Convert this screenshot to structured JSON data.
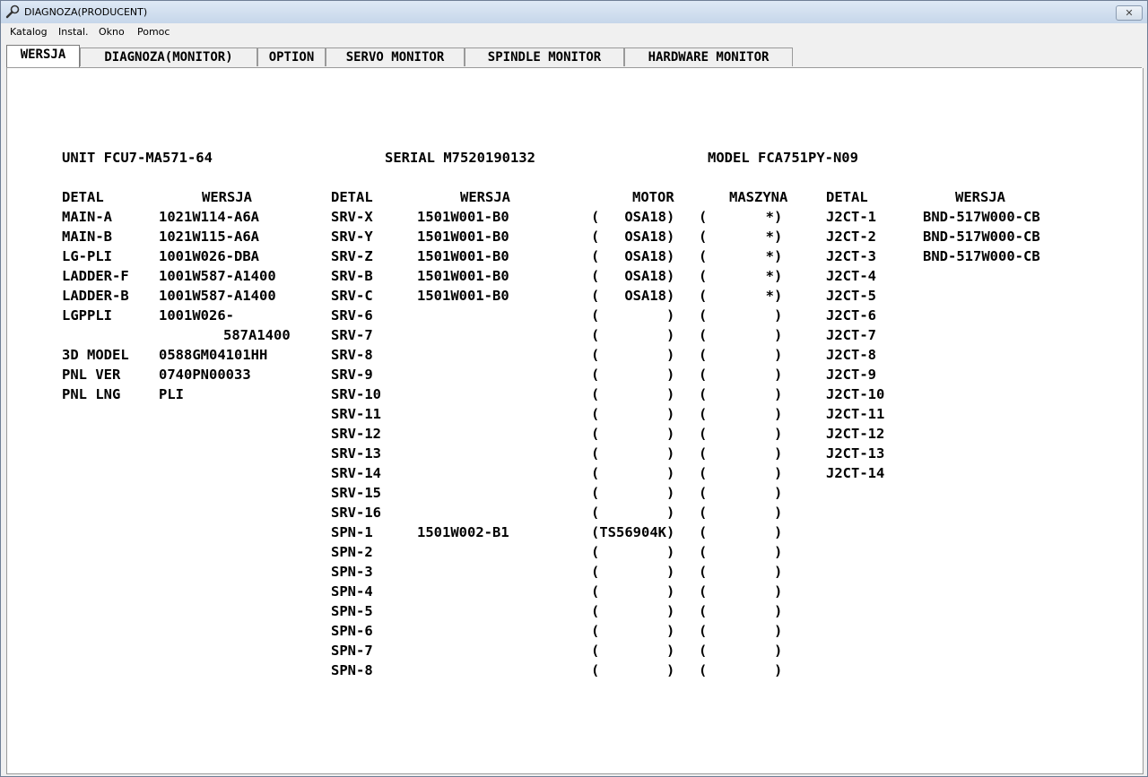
{
  "window": {
    "title": "DIAGNOZA(PRODUCENT)",
    "close_label": "✕"
  },
  "menu": [
    "Katalog",
    "Instal.",
    "Okno",
    "Pomoc"
  ],
  "tabs": [
    "WERSJA",
    "DIAGNOZA(MONITOR)",
    "OPTION",
    "SERVO MONITOR",
    "SPINDLE MONITOR",
    "HARDWARE MONITOR"
  ],
  "header": {
    "unit": "UNIT FCU7-MA571-64",
    "serial": "SERIAL M7520190132",
    "model": "MODEL FCA751PY-N09"
  },
  "columns": {
    "detal": "DETAL",
    "wersja": "WERSJA",
    "motor": "MOTOR",
    "maszyna": "MASZYNA"
  },
  "left_table": [
    {
      "detal": "MAIN-A",
      "wersja": "1021W114-A6A"
    },
    {
      "detal": "MAIN-B",
      "wersja": "1021W115-A6A"
    },
    {
      "detal": "LG-PLI",
      "wersja": "1001W026-DBA"
    },
    {
      "detal": "LADDER-F",
      "wersja": "1001W587-A1400"
    },
    {
      "detal": "LADDER-B",
      "wersja": "1001W587-A1400"
    },
    {
      "detal": "LGPPLI",
      "wersja": "1001W026-"
    },
    {
      "detal": "",
      "wersja": "587A1400",
      "indent": true
    },
    {
      "detal": "3D MODEL",
      "wersja": "0588GM04101HH"
    },
    {
      "detal": "PNL VER",
      "wersja": "0740PN00033"
    },
    {
      "detal": "PNL LNG",
      "wersja": "PLI"
    }
  ],
  "servo_table": [
    {
      "detal": "SRV-X",
      "wersja": "1501W001-B0",
      "motor": "(   OSA18)",
      "maszyna": "(       *)"
    },
    {
      "detal": "SRV-Y",
      "wersja": "1501W001-B0",
      "motor": "(   OSA18)",
      "maszyna": "(       *)"
    },
    {
      "detal": "SRV-Z",
      "wersja": "1501W001-B0",
      "motor": "(   OSA18)",
      "maszyna": "(       *)"
    },
    {
      "detal": "SRV-B",
      "wersja": "1501W001-B0",
      "motor": "(   OSA18)",
      "maszyna": "(       *)"
    },
    {
      "detal": "SRV-C",
      "wersja": "1501W001-B0",
      "motor": "(   OSA18)",
      "maszyna": "(       *)"
    },
    {
      "detal": "SRV-6",
      "wersja": "",
      "motor": "(        )",
      "maszyna": "(        )"
    },
    {
      "detal": "SRV-7",
      "wersja": "",
      "motor": "(        )",
      "maszyna": "(        )"
    },
    {
      "detal": "SRV-8",
      "wersja": "",
      "motor": "(        )",
      "maszyna": "(        )"
    },
    {
      "detal": "SRV-9",
      "wersja": "",
      "motor": "(        )",
      "maszyna": "(        )"
    },
    {
      "detal": "SRV-10",
      "wersja": "",
      "motor": "(        )",
      "maszyna": "(        )"
    },
    {
      "detal": "SRV-11",
      "wersja": "",
      "motor": "(        )",
      "maszyna": "(        )"
    },
    {
      "detal": "SRV-12",
      "wersja": "",
      "motor": "(        )",
      "maszyna": "(        )"
    },
    {
      "detal": "SRV-13",
      "wersja": "",
      "motor": "(        )",
      "maszyna": "(        )"
    },
    {
      "detal": "SRV-14",
      "wersja": "",
      "motor": "(        )",
      "maszyna": "(        )"
    },
    {
      "detal": "SRV-15",
      "wersja": "",
      "motor": "(        )",
      "maszyna": "(        )"
    },
    {
      "detal": "SRV-16",
      "wersja": "",
      "motor": "(        )",
      "maszyna": "(        )"
    },
    {
      "detal": "SPN-1",
      "wersja": "1501W002-B1",
      "motor": "(TS56904K)",
      "maszyna": "(        )"
    },
    {
      "detal": "SPN-2",
      "wersja": "",
      "motor": "(        )",
      "maszyna": "(        )"
    },
    {
      "detal": "SPN-3",
      "wersja": "",
      "motor": "(        )",
      "maszyna": "(        )"
    },
    {
      "detal": "SPN-4",
      "wersja": "",
      "motor": "(        )",
      "maszyna": "(        )"
    },
    {
      "detal": "SPN-5",
      "wersja": "",
      "motor": "(        )",
      "maszyna": "(        )"
    },
    {
      "detal": "SPN-6",
      "wersja": "",
      "motor": "(        )",
      "maszyna": "(        )"
    },
    {
      "detal": "SPN-7",
      "wersja": "",
      "motor": "(        )",
      "maszyna": "(        )"
    },
    {
      "detal": "SPN-8",
      "wersja": "",
      "motor": "(        )",
      "maszyna": "(        )"
    }
  ],
  "j2ct_table": [
    {
      "detal": "J2CT-1",
      "wersja": "BND-517W000-CB"
    },
    {
      "detal": "J2CT-2",
      "wersja": "BND-517W000-CB"
    },
    {
      "detal": "J2CT-3",
      "wersja": "BND-517W000-CB"
    },
    {
      "detal": "J2CT-4",
      "wersja": ""
    },
    {
      "detal": "J2CT-5",
      "wersja": ""
    },
    {
      "detal": "J2CT-6",
      "wersja": ""
    },
    {
      "detal": "J2CT-7",
      "wersja": ""
    },
    {
      "detal": "J2CT-8",
      "wersja": ""
    },
    {
      "detal": "J2CT-9",
      "wersja": ""
    },
    {
      "detal": "J2CT-10",
      "wersja": ""
    },
    {
      "detal": "J2CT-11",
      "wersja": ""
    },
    {
      "detal": "J2CT-12",
      "wersja": ""
    },
    {
      "detal": "J2CT-13",
      "wersja": ""
    },
    {
      "detal": "J2CT-14",
      "wersja": ""
    }
  ]
}
